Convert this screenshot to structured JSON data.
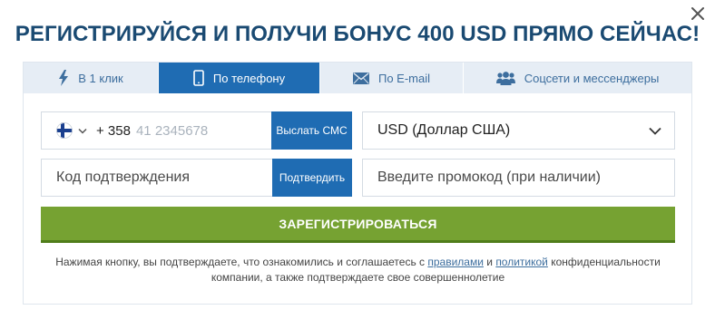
{
  "header": {
    "title": "РЕГИСТРИРУЙСЯ И ПОЛУЧИ БОНУС 400 USD ПРЯМО СЕЙЧАС!"
  },
  "tabs": [
    {
      "label": "В 1 клик",
      "icon": "lightning-icon",
      "active": false
    },
    {
      "label": "По телефону",
      "icon": "phone-icon",
      "active": true
    },
    {
      "label": "По E-mail",
      "icon": "envelope-icon",
      "active": false
    },
    {
      "label": "Соцсети и мессенджеры",
      "icon": "users-icon",
      "active": false
    }
  ],
  "form": {
    "country_flag": "finland-flag",
    "dial_code": "+ 358",
    "phone_placeholder": "41 2345678",
    "sms_button": "Выслать СМС",
    "currency_value": "USD (Доллар США)",
    "code_placeholder": "Код подтверждения",
    "confirm_button": "Подтвердить",
    "promo_placeholder": "Введите промокод (при наличии)",
    "register_button": "ЗАРЕГИСТРИРОВАТЬСЯ"
  },
  "disclaimer": {
    "text_before": "Нажимая кнопку, вы подтверждаете, что ознакомились и соглашаетесь с ",
    "link_rules": "правилами",
    "text_and": " и ",
    "link_policy": "политикой",
    "text_after": " конфиденциальности компании, а также подтверждаете свое совершеннолетие"
  },
  "colors": {
    "title": "#1a4a72",
    "tab_bg": "#e6edf5",
    "tab_active": "#1f6cb3",
    "register": "#76a232",
    "link": "#3d6e9e"
  }
}
